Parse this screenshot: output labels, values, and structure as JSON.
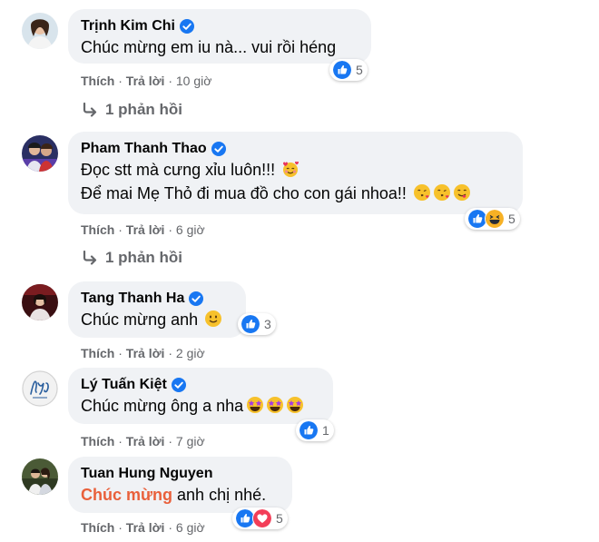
{
  "comments": [
    {
      "author": "Trịnh Kim Chi",
      "verified": true,
      "text": "Chúc mừng em iu nà... vui rồi héng",
      "like": "Thích",
      "reply": "Trả lời",
      "time": "10 giờ",
      "reaction_count": "5",
      "reactions": [
        "like-icon"
      ],
      "replies_label": "1 phản hồi"
    },
    {
      "author": "Pham Thanh Thao",
      "verified": true,
      "text_line1": "Đọc stt mà cưng xỉu luôn!!!",
      "text_line2": "Để mai Mẹ Thỏ đi mua đồ cho con gái nhoa!!",
      "like": "Thích",
      "reply": "Trả lời",
      "time": "6 giờ",
      "reaction_count": "5",
      "reactions": [
        "like-icon",
        "haha-icon"
      ],
      "replies_label": "1 phản hồi"
    },
    {
      "author": "Tang Thanh Ha",
      "verified": true,
      "text": "Chúc mừng anh",
      "like": "Thích",
      "reply": "Trả lời",
      "time": "2 giờ",
      "reaction_count": "3",
      "reactions": [
        "like-icon"
      ]
    },
    {
      "author": "Lý Tuấn Kiệt",
      "verified": true,
      "text": "Chúc mừng ông a nha",
      "like": "Thích",
      "reply": "Trả lời",
      "time": "7 giờ",
      "reaction_count": "1",
      "reactions": [
        "like-icon"
      ]
    },
    {
      "author": "Tuan Hung Nguyen",
      "verified": false,
      "mention": "Chúc mừng",
      "text_rest": " anh chị nhé.",
      "like": "Thích",
      "reply": "Trả lời",
      "time": "6 giờ",
      "reaction_count": "5",
      "reactions": [
        "like-icon",
        "love-icon"
      ]
    }
  ],
  "separator": "·",
  "colors": {
    "bubble": "#f0f2f5",
    "meta": "#65676b",
    "like_blue": "#1877f2",
    "love_red": "#f33e58",
    "mention": "#e9603b"
  }
}
